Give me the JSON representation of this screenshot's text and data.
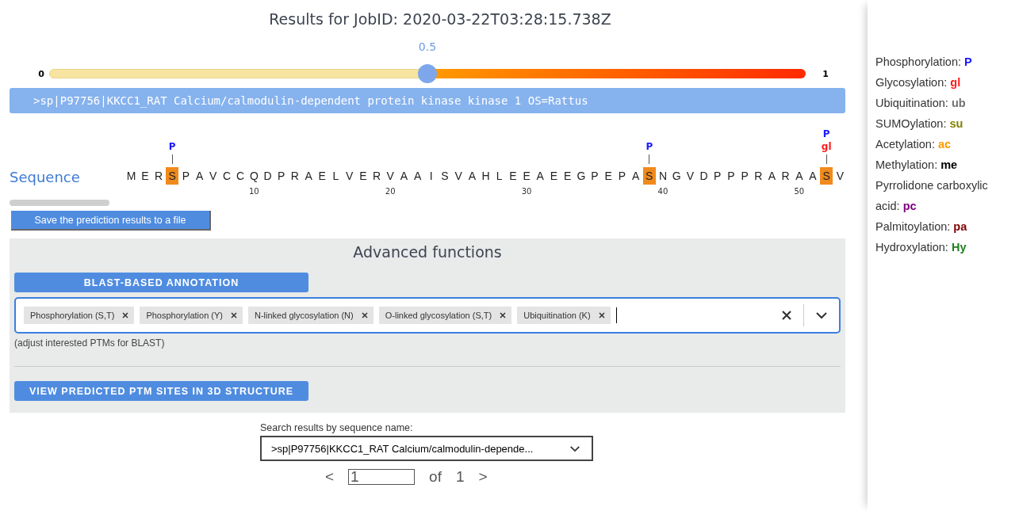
{
  "title": "Results for JobID: 2020-03-22T03:28:15.738Z",
  "threshold": {
    "min_label": "0",
    "max_label": "1",
    "reading": "0.5",
    "level": 0.5
  },
  "sequence_header": ">sp|P97756|KKCC1_RAT Calcium/calmodulin-dependent protein kinase kinase 1 OS=Rattus",
  "sequence": {
    "label": "Sequence",
    "residues": [
      {
        "aa": "M",
        "site": false
      },
      {
        "aa": "E",
        "site": false
      },
      {
        "aa": "R",
        "site": false
      },
      {
        "aa": "S",
        "site": true,
        "marks": [
          {
            "label": "P",
            "color": "#1a1aff"
          }
        ]
      },
      {
        "aa": "P",
        "site": false
      },
      {
        "aa": "A",
        "site": false
      },
      {
        "aa": "V",
        "site": false
      },
      {
        "aa": "C",
        "site": false
      },
      {
        "aa": "C",
        "site": false
      },
      {
        "aa": "Q",
        "site": false,
        "tick": "10"
      },
      {
        "aa": "D",
        "site": false
      },
      {
        "aa": "P",
        "site": false
      },
      {
        "aa": "R",
        "site": false
      },
      {
        "aa": "A",
        "site": false
      },
      {
        "aa": "E",
        "site": false
      },
      {
        "aa": "L",
        "site": false
      },
      {
        "aa": "V",
        "site": false
      },
      {
        "aa": "E",
        "site": false
      },
      {
        "aa": "R",
        "site": false
      },
      {
        "aa": "V",
        "site": false,
        "tick": "20"
      },
      {
        "aa": "A",
        "site": false
      },
      {
        "aa": "A",
        "site": false
      },
      {
        "aa": "I",
        "site": false
      },
      {
        "aa": "S",
        "site": false
      },
      {
        "aa": "V",
        "site": false
      },
      {
        "aa": "A",
        "site": false
      },
      {
        "aa": "H",
        "site": false
      },
      {
        "aa": "L",
        "site": false
      },
      {
        "aa": "E",
        "site": false
      },
      {
        "aa": "E",
        "site": false,
        "tick": "30"
      },
      {
        "aa": "A",
        "site": false
      },
      {
        "aa": "E",
        "site": false
      },
      {
        "aa": "E",
        "site": false
      },
      {
        "aa": "G",
        "site": false
      },
      {
        "aa": "P",
        "site": false
      },
      {
        "aa": "E",
        "site": false
      },
      {
        "aa": "P",
        "site": false
      },
      {
        "aa": "A",
        "site": false
      },
      {
        "aa": "S",
        "site": true,
        "marks": [
          {
            "label": "P",
            "color": "#1a1aff"
          }
        ]
      },
      {
        "aa": "N",
        "site": false,
        "tick": "40"
      },
      {
        "aa": "G",
        "site": false
      },
      {
        "aa": "V",
        "site": false
      },
      {
        "aa": "D",
        "site": false
      },
      {
        "aa": "P",
        "site": false
      },
      {
        "aa": "P",
        "site": false
      },
      {
        "aa": "P",
        "site": false
      },
      {
        "aa": "R",
        "site": false
      },
      {
        "aa": "A",
        "site": false
      },
      {
        "aa": "R",
        "site": false
      },
      {
        "aa": "A",
        "site": false,
        "tick": "50"
      },
      {
        "aa": "A",
        "site": false
      },
      {
        "aa": "S",
        "site": true,
        "marks": [
          {
            "label": "P",
            "color": "#1a1aff"
          },
          {
            "label": "gl",
            "color": "#ff1a1a"
          }
        ]
      },
      {
        "aa": "V",
        "site": false
      }
    ]
  },
  "save_button": "Save the prediction results to a file",
  "advanced": {
    "title": "Advanced functions",
    "blast_button": "BLAST-BASED ANNOTATION",
    "ptm_tags": [
      "Phosphorylation (S,T)",
      "Phosphorylation (Y)",
      "N-linked glycosylation (N)",
      "O-linked glycosylation (S,T)",
      "Ubiquitination (K)"
    ],
    "hint": "(adjust interested PTMs for BLAST)",
    "structure_button": "VIEW PREDICTED PTM SITES IN 3D STRUCTURE"
  },
  "search": {
    "label": "Search results by sequence name:",
    "value": ">sp|P97756|KKCC1_RAT Calcium/calmodulin-depende..."
  },
  "pagination": {
    "prev": "<",
    "page": "1",
    "of": "of",
    "total": "1",
    "next": ">"
  },
  "legend": [
    {
      "name": "Phosphorylation: ",
      "abbr": "P",
      "color": "#1a1aff"
    },
    {
      "name": "Glycosylation: ",
      "abbr": "gl",
      "color": "#ff1a1a"
    },
    {
      "name": "Ubiquitination: ",
      "abbr": "ub",
      "color": "#707070"
    },
    {
      "name": "SUMOylation: ",
      "abbr": "su",
      "color": "#808000"
    },
    {
      "name": "Acetylation: ",
      "abbr": "ac",
      "color": "#ff9900"
    },
    {
      "name": "Methylation: ",
      "abbr": "me",
      "color": "#000000"
    },
    {
      "name": "Pyrrolidone carboxylic acid: ",
      "abbr": "pc",
      "color": "#800080"
    },
    {
      "name": "Palmitoylation: ",
      "abbr": "pa",
      "color": "#800000"
    },
    {
      "name": "Hydroxylation: ",
      "abbr": "Hy",
      "color": "#208020"
    }
  ]
}
